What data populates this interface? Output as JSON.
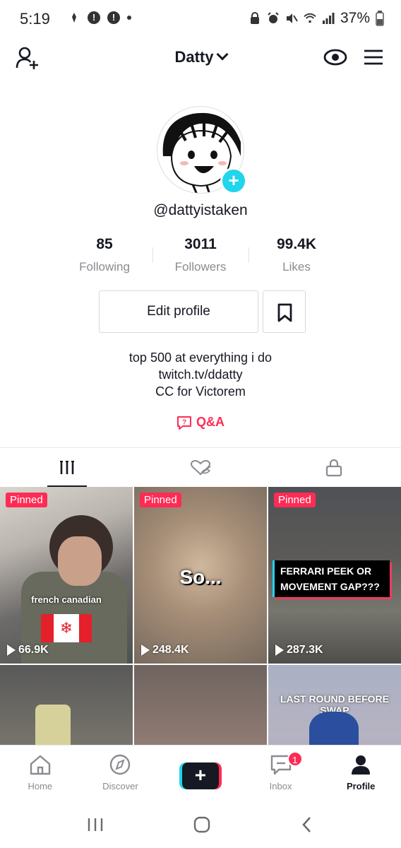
{
  "status_bar": {
    "time": "5:19",
    "battery": "37%"
  },
  "header": {
    "title": "Datty"
  },
  "profile": {
    "username": "@dattyistaken",
    "stats": [
      {
        "value": "85",
        "label": "Following"
      },
      {
        "value": "3011",
        "label": "Followers"
      },
      {
        "value": "99.4K",
        "label": "Likes"
      }
    ],
    "edit_label": "Edit profile",
    "bio": [
      "top 500 at everything i do",
      "twitch.tv/ddatty",
      "CC for Victorem"
    ],
    "qa_label": "Q&A"
  },
  "videos": [
    {
      "pinned": "Pinned",
      "views": "66.9K",
      "caption": "french canadian"
    },
    {
      "pinned": "Pinned",
      "views": "248.4K",
      "caption": "So..."
    },
    {
      "pinned": "Pinned",
      "views": "287.3K",
      "caption": "FERRARI PEEK OR MOVEMENT GAP???"
    },
    {
      "views": ""
    },
    {
      "views": ""
    },
    {
      "views": "",
      "caption": "LAST ROUND BEFORE SWAP"
    }
  ],
  "nav": {
    "home": "Home",
    "discover": "Discover",
    "inbox": "Inbox",
    "inbox_badge": "1",
    "profile": "Profile"
  },
  "colors": {
    "accent": "#fe2c55",
    "cyan": "#20d5ec",
    "text": "#161823",
    "muted": "#8a8b91"
  }
}
